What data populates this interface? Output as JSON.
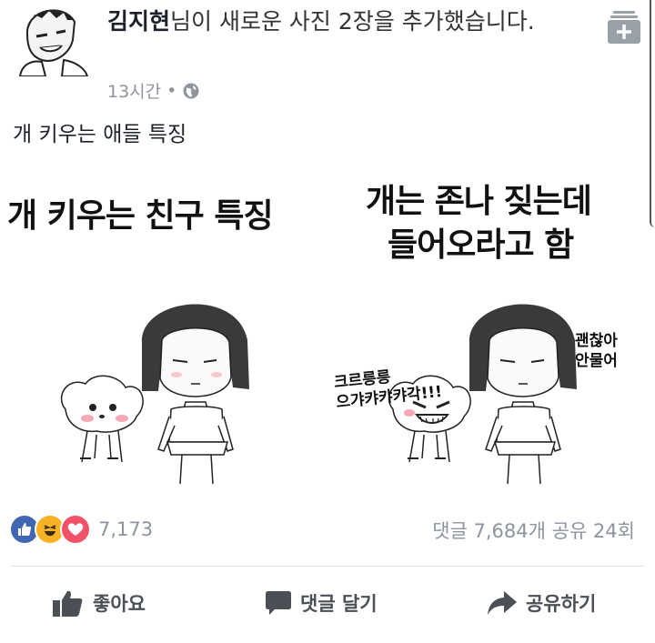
{
  "post": {
    "author": "김지현",
    "action_text": "님이 새로운 사진 2장을 추가했습니다.",
    "time": "13시간",
    "separator": "•",
    "caption": "개 키우는 애들 특징",
    "privacy_icon": "globe-icon"
  },
  "image": {
    "panel1_title": "개 키우는 친구 특징",
    "panel2_title_line1": "개는 존나 짖는데",
    "panel2_title_line2": "들어오라고 함",
    "bubble_growl_line1": "크르릉릉",
    "bubble_growl_line2": "으갸캬캬캬각!!!",
    "bubble_ok_line1": "괜찮아",
    "bubble_ok_line2": "안물어"
  },
  "engagement": {
    "reaction_count": "7,173",
    "stats": "댓글 7,684개 공유 24회",
    "reactions": [
      "like-reaction-icon",
      "haha-reaction-icon",
      "love-reaction-icon"
    ]
  },
  "actions": {
    "like": "좋아요",
    "comment": "댓글 달기",
    "share": "공유하기"
  },
  "colors": {
    "like_blue": "#4267b2",
    "love_red": "#f25268",
    "haha_yellow": "#f7b125",
    "meta_gray": "#90949c"
  }
}
